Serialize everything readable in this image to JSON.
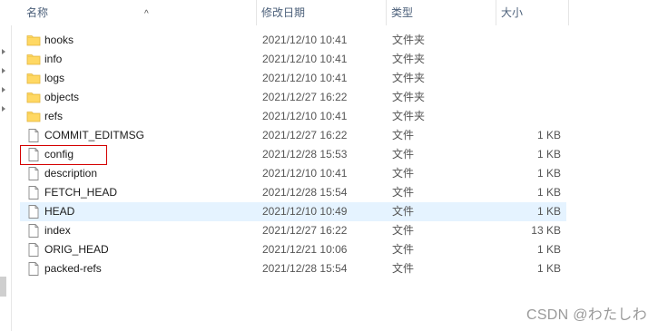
{
  "header": {
    "name_label": "名称",
    "modified_label": "修改日期",
    "type_label": "类型",
    "size_label": "大小"
  },
  "files": [
    {
      "name": "hooks",
      "modified": "2021/12/10 10:41",
      "type": "文件夹",
      "size": "",
      "kind": "folder-icon"
    },
    {
      "name": "info",
      "modified": "2021/12/10 10:41",
      "type": "文件夹",
      "size": "",
      "kind": "folder-icon"
    },
    {
      "name": "logs",
      "modified": "2021/12/10 10:41",
      "type": "文件夹",
      "size": "",
      "kind": "folder-icon"
    },
    {
      "name": "objects",
      "modified": "2021/12/27 16:22",
      "type": "文件夹",
      "size": "",
      "kind": "folder-icon"
    },
    {
      "name": "refs",
      "modified": "2021/12/10 10:41",
      "type": "文件夹",
      "size": "",
      "kind": "folder-icon"
    },
    {
      "name": "COMMIT_EDITMSG",
      "modified": "2021/12/27 16:22",
      "type": "文件",
      "size": "1 KB",
      "kind": "file-icon"
    },
    {
      "name": "config",
      "modified": "2021/12/28 15:53",
      "type": "文件",
      "size": "1 KB",
      "kind": "file-icon"
    },
    {
      "name": "description",
      "modified": "2021/12/10 10:41",
      "type": "文件",
      "size": "1 KB",
      "kind": "file-icon"
    },
    {
      "name": "FETCH_HEAD",
      "modified": "2021/12/28 15:54",
      "type": "文件",
      "size": "1 KB",
      "kind": "file-icon"
    },
    {
      "name": "HEAD",
      "modified": "2021/12/10 10:49",
      "type": "文件",
      "size": "1 KB",
      "kind": "file-icon",
      "selected": true
    },
    {
      "name": "index",
      "modified": "2021/12/27 16:22",
      "type": "文件",
      "size": "13 KB",
      "kind": "file-icon"
    },
    {
      "name": "ORIG_HEAD",
      "modified": "2021/12/21 10:06",
      "type": "文件",
      "size": "1 KB",
      "kind": "file-icon"
    },
    {
      "name": "packed-refs",
      "modified": "2021/12/28 15:54",
      "type": "文件",
      "size": "1 KB",
      "kind": "file-icon"
    }
  ],
  "watermark": "CSDN @わたしわ",
  "colors": {
    "folder": "#ffd863",
    "selected_row": "#e5f3ff",
    "highlight_box": "#d40000"
  }
}
